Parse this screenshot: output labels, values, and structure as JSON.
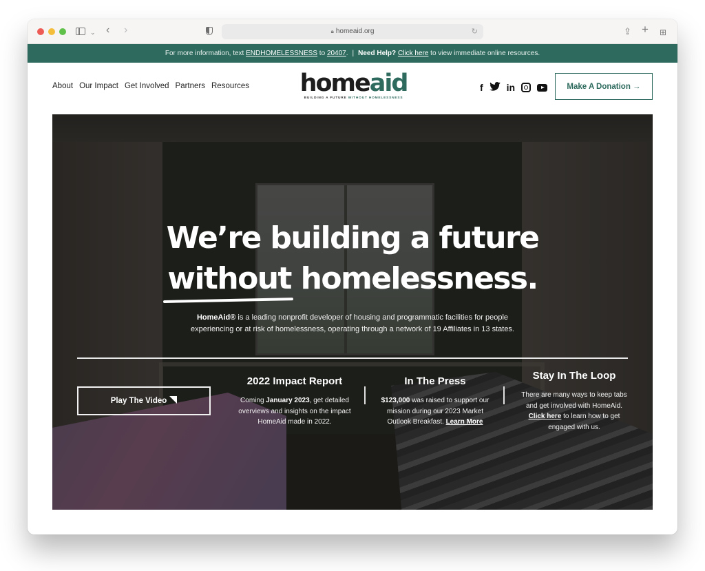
{
  "browser": {
    "url": "homeaid.org"
  },
  "announcement": {
    "prefix": "For more information, text ",
    "keyword": "ENDHOMELESSNESS",
    "to": " to ",
    "number": "20407",
    "period": ".",
    "separator": "|",
    "help_label": "Need Help?",
    "help_link": "Click here",
    "help_suffix": " to view immediate online resources."
  },
  "header": {
    "nav": [
      "About",
      "Our Impact",
      "Get Involved",
      "Partners",
      "Resources"
    ],
    "logo": {
      "home": "home",
      "aid": "aid",
      "tagline_a": "BUILDING A FUTURE ",
      "tagline_b": "WITHOUT HOMELESSNESS"
    },
    "social": [
      "facebook",
      "twitter",
      "linkedin",
      "instagram",
      "youtube"
    ],
    "donate_label": "Make A Donation →"
  },
  "hero": {
    "title_line1": "We’re building a future",
    "title_underlined": "without",
    "title_line2_rest": " homelessness.",
    "desc_brand": "HomeAid®",
    "desc_text": " is a leading nonprofit developer of housing and programmatic facilities for people experiencing or at risk of homelessness, operating through a network of 19 Affiliates in 13 states.",
    "play_label": "Play The Video",
    "columns": [
      {
        "title": "2022 Impact Report",
        "pre": "Coming ",
        "bold": "January 2023",
        "post": ", get detailed overviews and insights on the impact HomeAid made in 2022."
      },
      {
        "title": "In The Press",
        "bold": "$123,000",
        "post": " was raised to support our mission during our 2023 Market Outlook Breakfast. ",
        "link": "Learn More"
      },
      {
        "title": "Stay In The Loop",
        "pre": "There are many ways to keep tabs and get involved with HomeAid. ",
        "link": "Click here",
        "post": " to learn how to get engaged with us."
      }
    ]
  }
}
